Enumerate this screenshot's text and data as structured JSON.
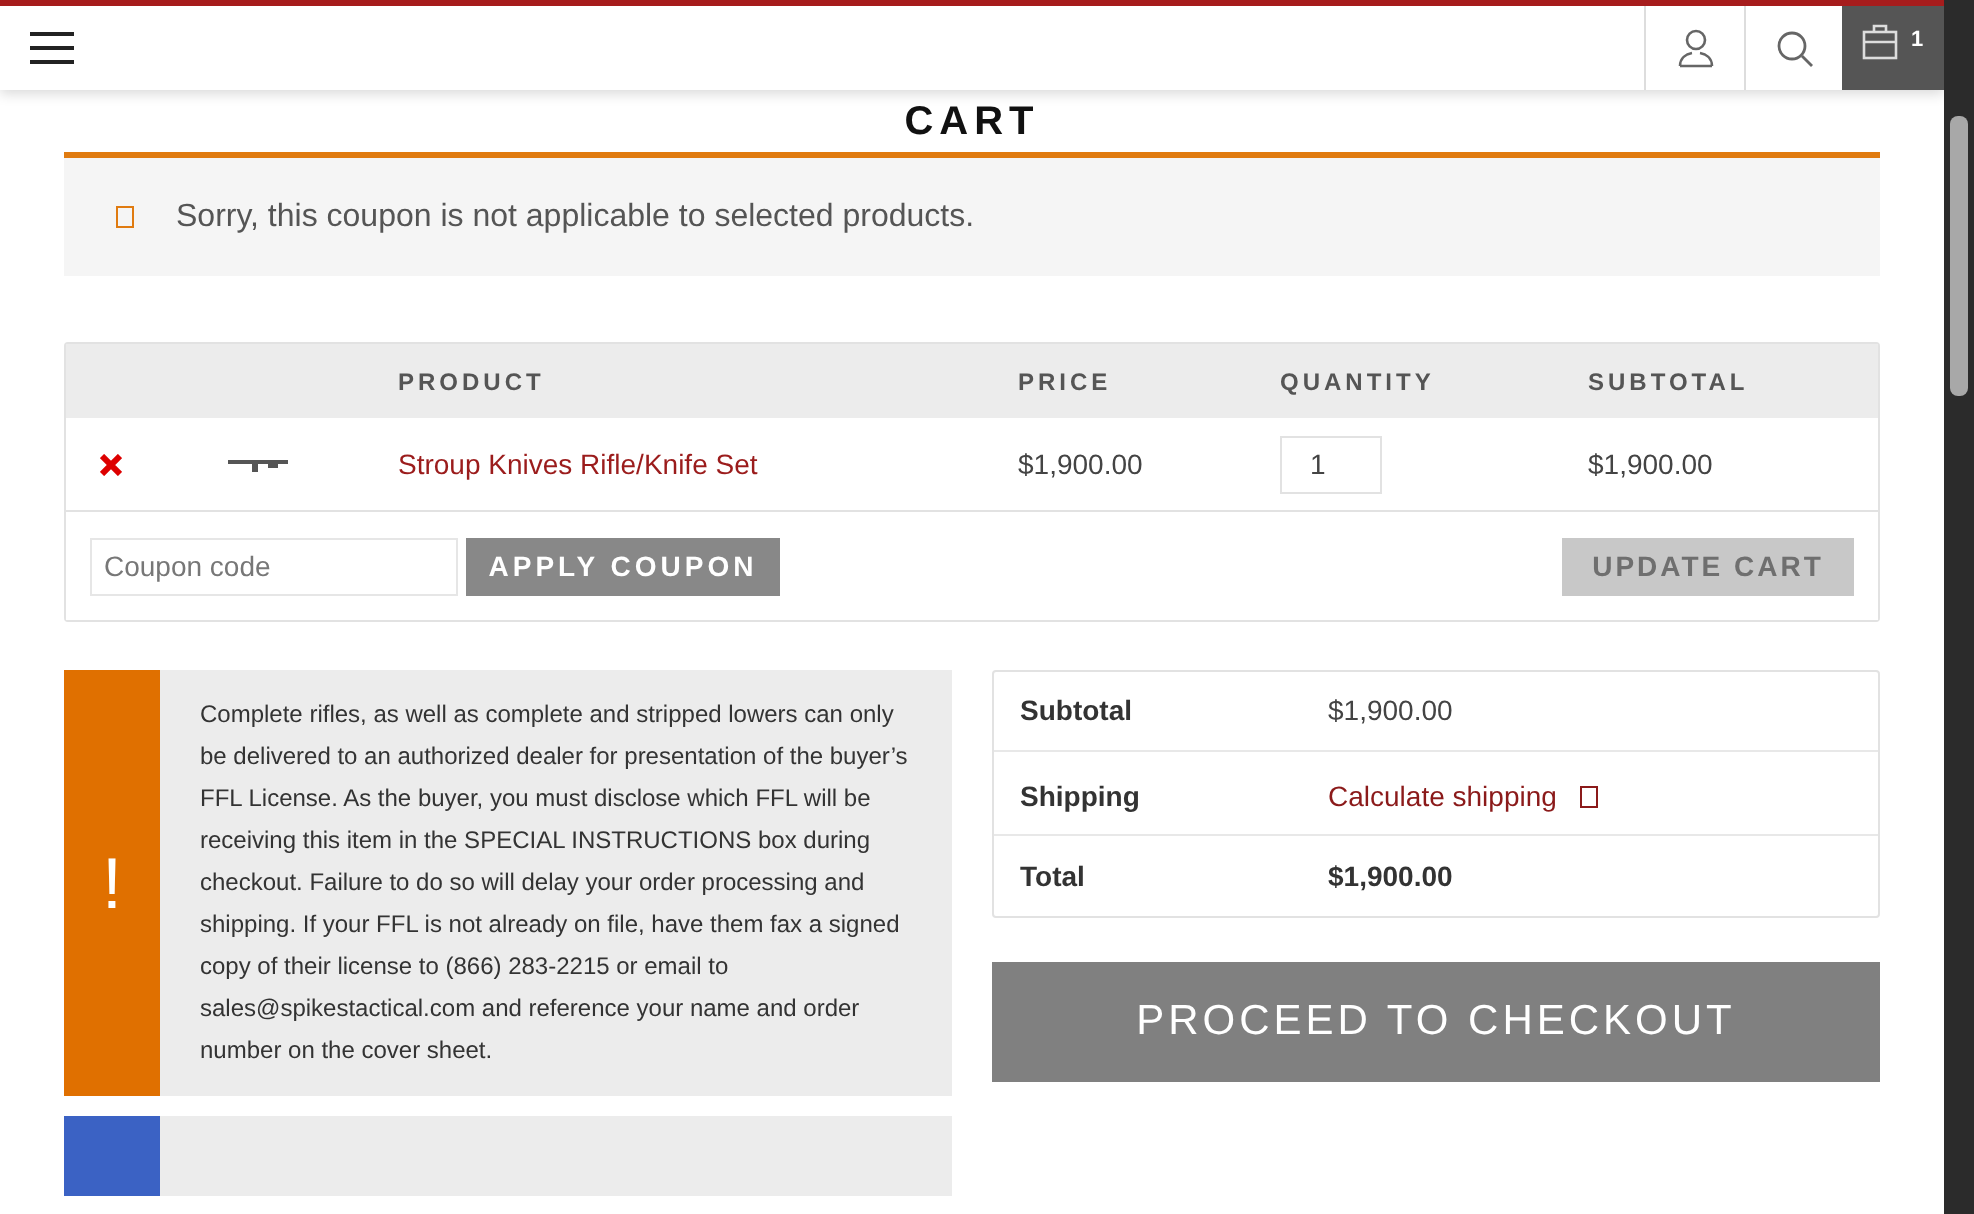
{
  "header": {
    "cart_count": "1"
  },
  "title": "CART",
  "error_message": "Sorry, this coupon is not applicable to selected products.",
  "cart_table": {
    "columns": [
      "PRODUCT",
      "PRICE",
      "QUANTITY",
      "SUBTOTAL"
    ],
    "rows": [
      {
        "product": "Stroup Knives Rifle/Knife Set",
        "price": "$1,900.00",
        "quantity": "1",
        "subtotal": "$1,900.00"
      }
    ]
  },
  "coupon": {
    "placeholder": "Coupon code",
    "apply_button": "APPLY COUPON"
  },
  "update_button": {
    "label": "UPDATE CART",
    "disabled": true
  },
  "notices": [
    {
      "color": "#e07000",
      "icon": "!",
      "text": "Complete rifles, as well as complete and stripped lowers can only be delivered to an authorized dealer for presentation of the buyer’s FFL License. As the buyer, you must disclose which FFL will be receiving this item in the SPECIAL INSTRUCTIONS box during checkout. Failure to do so will delay your order processing and shipping. If your FFL is not already on file, have them fax a signed copy of their license to (866) 283-2215 or email to sales@spikestactical.com and reference your name and order number on the cover sheet."
    },
    {
      "color": "#3b62c4"
    }
  ],
  "totals": [
    {
      "label": "Subtotal",
      "value": "$1,900.00",
      "kind": "plain"
    },
    {
      "label": "Shipping",
      "value": "Calculate shipping",
      "kind": "link"
    },
    {
      "label": "Total",
      "value": "$1,900.00",
      "kind": "bold"
    }
  ],
  "checkout_button": "PROCEED TO CHECKOUT"
}
